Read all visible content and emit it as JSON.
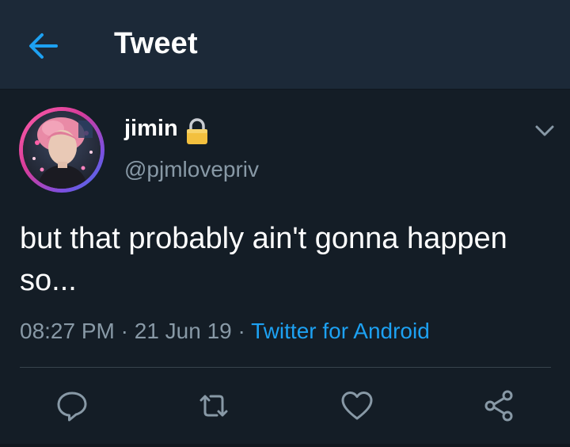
{
  "header": {
    "title": "Tweet",
    "back_icon": "arrow-left-icon"
  },
  "tweet": {
    "author_name": "jimin",
    "author_handle": "@pjmlovepriv",
    "protected_icon": "lock-icon",
    "text": "but that probably ain't gonna happen so...",
    "time": "08:27 PM",
    "separator": "·",
    "date": "21 Jun 19",
    "source": "Twitter for Android"
  },
  "actions": [
    {
      "name": "reply",
      "icon": "reply-icon"
    },
    {
      "name": "retweet",
      "icon": "retweet-icon"
    },
    {
      "name": "like",
      "icon": "heart-icon"
    },
    {
      "name": "share",
      "icon": "share-icon"
    }
  ],
  "colors": {
    "background": "#141d26",
    "header": "#1c2938",
    "accent": "#1da1f2",
    "muted": "#8899a6"
  }
}
